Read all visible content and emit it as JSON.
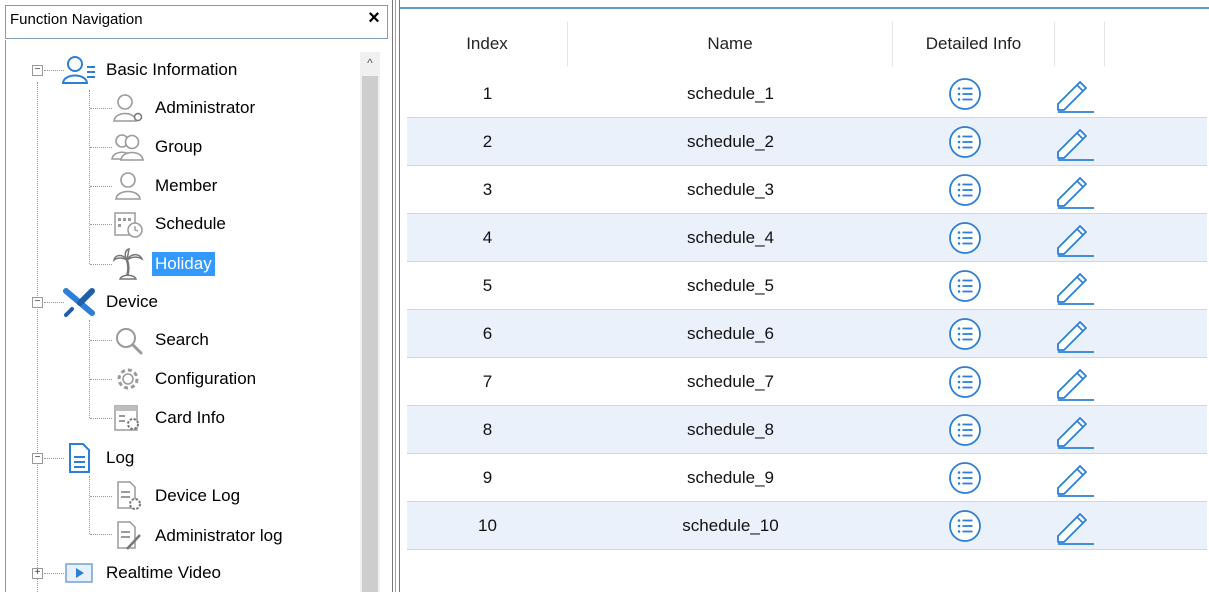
{
  "nav": {
    "title": "Function Navigation",
    "close_glyph": "×",
    "tree": {
      "basic": {
        "label": "Basic Information",
        "icon": "user-group-icon",
        "expander": "−"
      },
      "administrator": {
        "label": "Administrator",
        "icon": "user-gear-icon"
      },
      "group": {
        "label": "Group",
        "icon": "users-icon"
      },
      "member": {
        "label": "Member",
        "icon": "user-icon"
      },
      "schedule": {
        "label": "Schedule",
        "icon": "calendar-clock-icon"
      },
      "holiday": {
        "label": "Holiday",
        "icon": "palm-tree-icon",
        "selected": true
      },
      "device": {
        "label": "Device",
        "icon": "tools-icon",
        "expander": "−"
      },
      "search": {
        "label": "Search",
        "icon": "magnifier-icon"
      },
      "configuration": {
        "label": "Configuration",
        "icon": "gear-icon"
      },
      "card_info": {
        "label": "Card Info",
        "icon": "card-gear-icon"
      },
      "log": {
        "label": "Log",
        "icon": "document-icon",
        "expander": "−"
      },
      "device_log": {
        "label": "Device Log",
        "icon": "document-gear-icon"
      },
      "admin_log": {
        "label": "Administrator log",
        "icon": "document-pen-icon"
      },
      "realtime": {
        "label": "Realtime Video",
        "icon": "play-icon",
        "expander": "+"
      }
    }
  },
  "table": {
    "headers": {
      "index": "Index",
      "name": "Name",
      "detail": "Detailed Info"
    },
    "rows": [
      {
        "index": "1",
        "name": "schedule_1"
      },
      {
        "index": "2",
        "name": "schedule_2"
      },
      {
        "index": "3",
        "name": "schedule_3"
      },
      {
        "index": "4",
        "name": "schedule_4"
      },
      {
        "index": "5",
        "name": "schedule_5"
      },
      {
        "index": "6",
        "name": "schedule_6"
      },
      {
        "index": "7",
        "name": "schedule_7"
      },
      {
        "index": "8",
        "name": "schedule_8"
      },
      {
        "index": "9",
        "name": "schedule_9"
      },
      {
        "index": "10",
        "name": "schedule_10"
      }
    ],
    "row_icons": {
      "detail": "list-circle-icon",
      "edit": "pencil-icon"
    }
  },
  "colors": {
    "accent": "#3399ff",
    "row_alt": "#eaf1fb",
    "icon_blue": "#2b7fd6",
    "icon_gray": "#9a9a9a"
  }
}
